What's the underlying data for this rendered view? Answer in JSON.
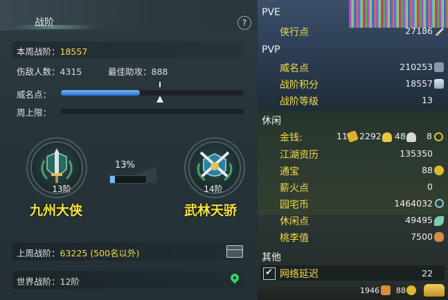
{
  "left_panel": {
    "title": "战阶",
    "help": "?",
    "current_rank_label": "本周战阶：",
    "current_rank_value": "18557",
    "kills_label": "伤敌人数：",
    "kills_value": "4315",
    "assist_label": "最佳助攻：",
    "assist_value": "888",
    "prestige_label": "威名点：",
    "prestige_progress": 0.43,
    "weekly_cap_label": "周上限：",
    "weekly_cap_progress": 0.0,
    "current_tier": {
      "level": "13阶",
      "name": "九州大侠"
    },
    "next_tier": {
      "level": "14阶",
      "name": "武林天骄"
    },
    "tier_progress_text": "13%",
    "tier_progress": 0.13,
    "last_week_label": "上周战阶：",
    "last_week_value": "63225 (500名以外)",
    "world_rank_label": "世界战阶：",
    "world_rank_value": "12阶"
  },
  "right_panel": {
    "pve_header": "PVE",
    "pvp_header": "PVP",
    "leisure_header": "休闲",
    "other_header": "其他",
    "pve": [
      {
        "label": "侠行点",
        "value": "27186",
        "icon": "sword-icon"
      }
    ],
    "pvp": [
      {
        "label": "威名点",
        "value": "210253",
        "icon": "flag-icon"
      },
      {
        "label": "战阶积分",
        "value": "18557",
        "icon": "badge-icon"
      },
      {
        "label": "战阶等级",
        "value": "13",
        "icon": ""
      }
    ],
    "money": {
      "label": "金钱:",
      "gold": "11",
      "silver": "2292",
      "copper": "48",
      "other": "8"
    },
    "leisure": [
      {
        "label": "江湖资历",
        "value": "135350",
        "icon": ""
      },
      {
        "label": "通宝",
        "value": "88",
        "icon": "coin-icon"
      },
      {
        "label": "薪火点",
        "value": "0",
        "icon": ""
      },
      {
        "label": "园宅币",
        "value": "1464032",
        "icon": "swirl-icon"
      },
      {
        "label": "休闲点",
        "value": "49495",
        "icon": "leaf-icon"
      },
      {
        "label": "桃李值",
        "value": "7500",
        "icon": "pouch-icon"
      }
    ],
    "network_label": "网络延迟",
    "network_value": "22",
    "bottom": {
      "value1": "1946",
      "value2": "88"
    }
  },
  "colors": {
    "accent_yellow": "#f3dc4a",
    "bar_blue": "#3f86e6",
    "pin_green": "#2fd36b"
  }
}
